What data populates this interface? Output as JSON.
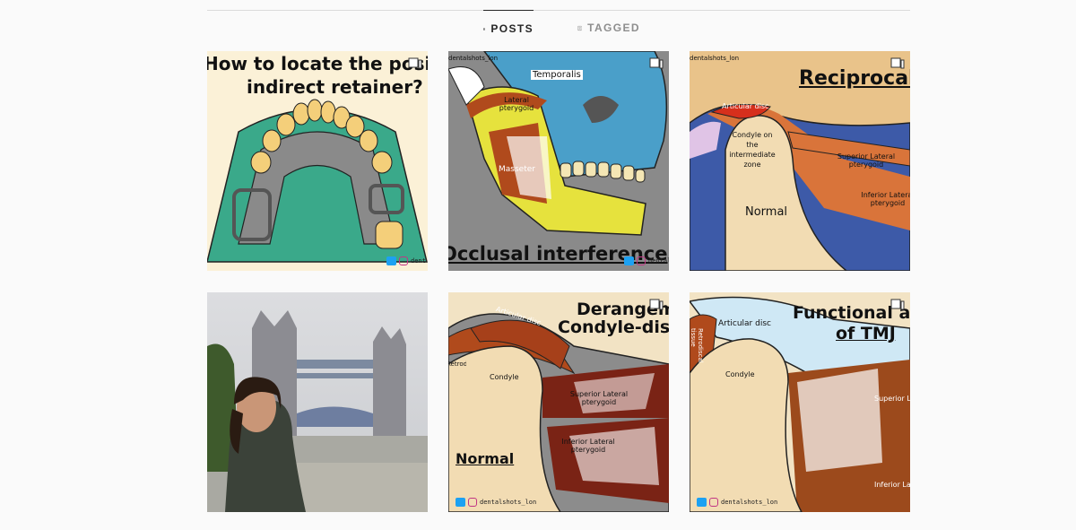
{
  "tabs": [
    {
      "label": "POSTS",
      "icon": "grid-icon",
      "active": true
    },
    {
      "label": "TAGGED",
      "icon": "tagged-person-icon",
      "active": false
    }
  ],
  "posts": [
    {
      "title_line1": "How to locate the position of",
      "title_line2": "indirect retainer?",
      "watermark": "dentalshots_lon",
      "multi_image": true
    },
    {
      "labels": [
        "Temporalis",
        "Lateral pterygoid",
        "Masseter"
      ],
      "title": "Occlusal interference",
      "watermark": "dentalshots_lon",
      "watermark_bottom": "dentalshots_lon",
      "multi_image": true
    },
    {
      "title": "Reciprocal clicking",
      "labels": [
        "Articular disc",
        "Condyle on the intermediate zone",
        "Superior Lateral pterygoid",
        "Inferior Lateral pterygoid",
        "Normal"
      ],
      "watermark": "dentalshots_lon",
      "multi_image": true
    },
    {
      "description": "Photo",
      "multi_image": false
    },
    {
      "title_line1": "Derangement of",
      "title_line2": "Condyle-disk complex",
      "labels": [
        "Articular disc",
        "Retrodiscal tissue",
        "Condyle",
        "Superior Lateral pterygoid",
        "Inferior Lateral pterygoid",
        "Normal"
      ],
      "watermark": "dentalshots_lon",
      "multi_image": true
    },
    {
      "title_line1": "Functional anatomy",
      "title_line2": "of TMJ",
      "labels": [
        "Articular disc",
        "Retrodiscal tissue",
        "Condyle",
        "Superior Lateral pterygoid",
        "Inferior Lateral pterygoid"
      ],
      "watermark": "dentalshots_lon",
      "multi_image": true
    }
  ],
  "colors": {
    "active_tab": "#262626",
    "inactive_tab": "#8e8e8e",
    "divider": "#dbdbdb",
    "background": "#fafafa"
  }
}
